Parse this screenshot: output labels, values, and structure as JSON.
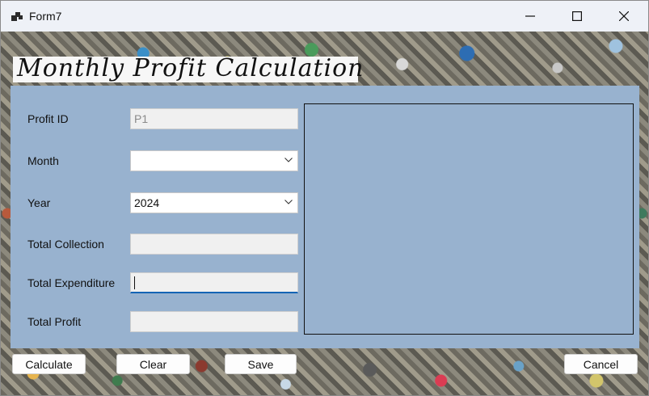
{
  "window": {
    "title": "Form7"
  },
  "heading": "Monthly Profit Calculation",
  "form": {
    "profit_id": {
      "label": "Profit ID",
      "value": "P1"
    },
    "month": {
      "label": "Month",
      "value": ""
    },
    "year": {
      "label": "Year",
      "value": "2024"
    },
    "total_collection": {
      "label": "Total Collection",
      "value": ""
    },
    "total_expenditure": {
      "label": "Total Expenditure",
      "value": ""
    },
    "total_profit": {
      "label": "Total Profit",
      "value": ""
    }
  },
  "buttons": {
    "calculate": "Calculate",
    "clear": "Clear",
    "save": "Save",
    "cancel": "Cancel"
  },
  "colors": {
    "panel": "#98b2cf",
    "focus_accent": "#1464b4"
  }
}
